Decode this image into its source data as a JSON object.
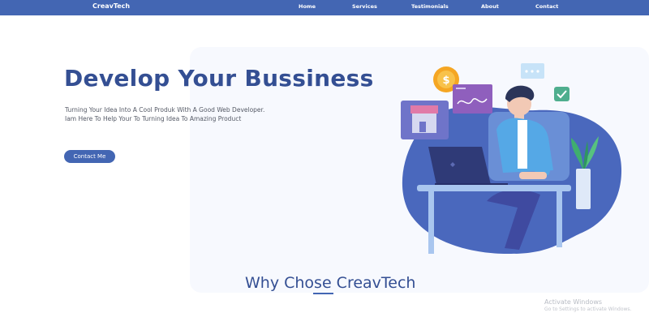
{
  "navbar": {
    "brand": "CreavTech",
    "items": [
      "Home",
      "Services",
      "Testimonials",
      "About",
      "Contact"
    ]
  },
  "hero": {
    "title": "Develop Your Bussiness",
    "description_line1": "Turning Your Idea Into A Cool Produk With A Good Web Developer.",
    "description_line2": "Iam Here To Help Your To Turning Idea To Amazing Product",
    "cta_label": "Contact Me",
    "coin_symbol": "$"
  },
  "section": {
    "title": "Why Chose CreavTech"
  },
  "watermark": {
    "title": "Activate Windows",
    "subtitle": "Go to Settings to activate Windows."
  },
  "colors": {
    "primary": "#4366b3",
    "heading": "#344f93",
    "panel": "#f7f9fe"
  }
}
